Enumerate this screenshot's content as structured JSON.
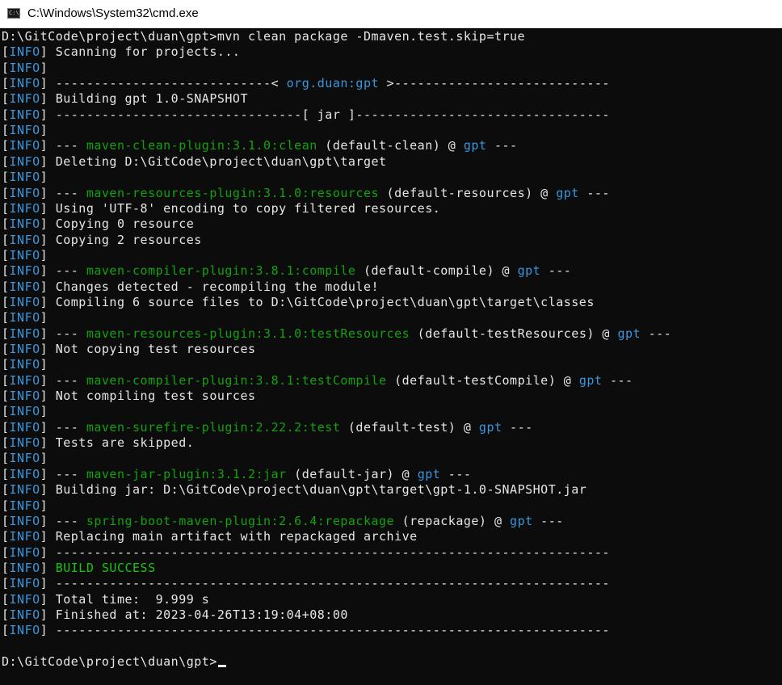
{
  "window": {
    "title": "C:\\Windows\\System32\\cmd.exe",
    "icon": "cmd-icon",
    "icon_text": "C:\\."
  },
  "console": {
    "command_line": "D:\\GitCode\\project\\duan\\gpt>mvn clean package -Dmaven.test.skip=true",
    "lines": [
      {
        "level": "INFO",
        "segments": [
          {
            "text": "Scanning for projects...",
            "color": "white"
          }
        ]
      },
      {
        "level": "INFO",
        "segments": []
      },
      {
        "level": "INFO",
        "segments": [
          {
            "text": "----------------------------< ",
            "color": "white"
          },
          {
            "text": "org.duan:gpt",
            "color": "blue"
          },
          {
            "text": " >----------------------------",
            "color": "white"
          }
        ]
      },
      {
        "level": "INFO",
        "segments": [
          {
            "text": "Building gpt 1.0-SNAPSHOT",
            "color": "white"
          }
        ]
      },
      {
        "level": "INFO",
        "segments": [
          {
            "text": "--------------------------------[ jar ]---------------------------------",
            "color": "white"
          }
        ]
      },
      {
        "level": "INFO",
        "segments": []
      },
      {
        "level": "INFO",
        "segments": [
          {
            "text": "--- ",
            "color": "white"
          },
          {
            "text": "maven-clean-plugin:3.1.0:clean",
            "color": "green"
          },
          {
            "text": " (default-clean) @ ",
            "color": "white"
          },
          {
            "text": "gpt",
            "color": "blue"
          },
          {
            "text": " ---",
            "color": "white"
          }
        ]
      },
      {
        "level": "INFO",
        "segments": [
          {
            "text": "Deleting D:\\GitCode\\project\\duan\\gpt\\target",
            "color": "white"
          }
        ]
      },
      {
        "level": "INFO",
        "segments": []
      },
      {
        "level": "INFO",
        "segments": [
          {
            "text": "--- ",
            "color": "white"
          },
          {
            "text": "maven-resources-plugin:3.1.0:resources",
            "color": "green"
          },
          {
            "text": " (default-resources) @ ",
            "color": "white"
          },
          {
            "text": "gpt",
            "color": "blue"
          },
          {
            "text": " ---",
            "color": "white"
          }
        ]
      },
      {
        "level": "INFO",
        "segments": [
          {
            "text": "Using 'UTF-8' encoding to copy filtered resources.",
            "color": "white"
          }
        ]
      },
      {
        "level": "INFO",
        "segments": [
          {
            "text": "Copying 0 resource",
            "color": "white"
          }
        ]
      },
      {
        "level": "INFO",
        "segments": [
          {
            "text": "Copying 2 resources",
            "color": "white"
          }
        ]
      },
      {
        "level": "INFO",
        "segments": []
      },
      {
        "level": "INFO",
        "segments": [
          {
            "text": "--- ",
            "color": "white"
          },
          {
            "text": "maven-compiler-plugin:3.8.1:compile",
            "color": "green"
          },
          {
            "text": " (default-compile) @ ",
            "color": "white"
          },
          {
            "text": "gpt",
            "color": "blue"
          },
          {
            "text": " ---",
            "color": "white"
          }
        ]
      },
      {
        "level": "INFO",
        "segments": [
          {
            "text": "Changes detected - recompiling the module!",
            "color": "white"
          }
        ]
      },
      {
        "level": "INFO",
        "segments": [
          {
            "text": "Compiling 6 source files to D:\\GitCode\\project\\duan\\gpt\\target\\classes",
            "color": "white"
          }
        ]
      },
      {
        "level": "INFO",
        "segments": []
      },
      {
        "level": "INFO",
        "segments": [
          {
            "text": "--- ",
            "color": "white"
          },
          {
            "text": "maven-resources-plugin:3.1.0:testResources",
            "color": "green"
          },
          {
            "text": " (default-testResources) @ ",
            "color": "white"
          },
          {
            "text": "gpt",
            "color": "blue"
          },
          {
            "text": " ---",
            "color": "white"
          }
        ]
      },
      {
        "level": "INFO",
        "segments": [
          {
            "text": "Not copying test resources",
            "color": "white"
          }
        ]
      },
      {
        "level": "INFO",
        "segments": []
      },
      {
        "level": "INFO",
        "segments": [
          {
            "text": "--- ",
            "color": "white"
          },
          {
            "text": "maven-compiler-plugin:3.8.1:testCompile",
            "color": "green"
          },
          {
            "text": " (default-testCompile) @ ",
            "color": "white"
          },
          {
            "text": "gpt",
            "color": "blue"
          },
          {
            "text": " ---",
            "color": "white"
          }
        ]
      },
      {
        "level": "INFO",
        "segments": [
          {
            "text": "Not compiling test sources",
            "color": "white"
          }
        ]
      },
      {
        "level": "INFO",
        "segments": []
      },
      {
        "level": "INFO",
        "segments": [
          {
            "text": "--- ",
            "color": "white"
          },
          {
            "text": "maven-surefire-plugin:2.22.2:test",
            "color": "green"
          },
          {
            "text": " (default-test) @ ",
            "color": "white"
          },
          {
            "text": "gpt",
            "color": "blue"
          },
          {
            "text": " ---",
            "color": "white"
          }
        ]
      },
      {
        "level": "INFO",
        "segments": [
          {
            "text": "Tests are skipped.",
            "color": "white"
          }
        ]
      },
      {
        "level": "INFO",
        "segments": []
      },
      {
        "level": "INFO",
        "segments": [
          {
            "text": "--- ",
            "color": "white"
          },
          {
            "text": "maven-jar-plugin:3.1.2:jar",
            "color": "green"
          },
          {
            "text": " (default-jar) @ ",
            "color": "white"
          },
          {
            "text": "gpt",
            "color": "blue"
          },
          {
            "text": " ---",
            "color": "white"
          }
        ]
      },
      {
        "level": "INFO",
        "segments": [
          {
            "text": "Building jar: D:\\GitCode\\project\\duan\\gpt\\target\\gpt-1.0-SNAPSHOT.jar",
            "color": "white"
          }
        ]
      },
      {
        "level": "INFO",
        "segments": []
      },
      {
        "level": "INFO",
        "segments": [
          {
            "text": "--- ",
            "color": "white"
          },
          {
            "text": "spring-boot-maven-plugin:2.6.4:repackage",
            "color": "green"
          },
          {
            "text": " (repackage) @ ",
            "color": "white"
          },
          {
            "text": "gpt",
            "color": "blue"
          },
          {
            "text": " ---",
            "color": "white"
          }
        ]
      },
      {
        "level": "INFO",
        "segments": [
          {
            "text": "Replacing main artifact with repackaged archive",
            "color": "white"
          }
        ]
      },
      {
        "level": "INFO",
        "segments": [
          {
            "text": "------------------------------------------------------------------------",
            "color": "white"
          }
        ]
      },
      {
        "level": "INFO",
        "segments": [
          {
            "text": "BUILD SUCCESS",
            "color": "bright-green"
          }
        ]
      },
      {
        "level": "INFO",
        "segments": [
          {
            "text": "------------------------------------------------------------------------",
            "color": "white"
          }
        ]
      },
      {
        "level": "INFO",
        "segments": [
          {
            "text": "Total time:  9.999 s",
            "color": "white"
          }
        ]
      },
      {
        "level": "INFO",
        "segments": [
          {
            "text": "Finished at: 2023-04-26T13:19:04+08:00",
            "color": "white"
          }
        ]
      },
      {
        "level": "INFO",
        "segments": [
          {
            "text": "------------------------------------------------------------------------",
            "color": "white"
          }
        ]
      }
    ],
    "prompt": "D:\\GitCode\\project\\duan\\gpt>",
    "colors": {
      "background": "#0c0c0c",
      "white": "#e6e6e6",
      "blue": "#3a96dd",
      "green": "#13a10e",
      "bright-green": "#16c60c"
    }
  }
}
